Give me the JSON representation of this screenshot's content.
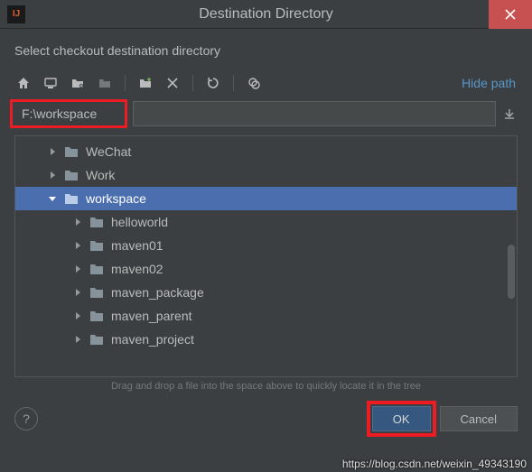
{
  "window": {
    "title": "Destination Directory",
    "app_icon_label": "IJ"
  },
  "prompt": "Select checkout destination directory",
  "toolbar": {
    "hide_path": "Hide path"
  },
  "path_input": {
    "value": "F:\\workspace"
  },
  "tree": {
    "items": [
      {
        "label": "WeChat",
        "depth": 1,
        "expanded": false,
        "selected": false
      },
      {
        "label": "Work",
        "depth": 1,
        "expanded": false,
        "selected": false
      },
      {
        "label": "workspace",
        "depth": 1,
        "expanded": true,
        "selected": true
      },
      {
        "label": "helloworld",
        "depth": 2,
        "expanded": false,
        "selected": false
      },
      {
        "label": "maven01",
        "depth": 2,
        "expanded": false,
        "selected": false
      },
      {
        "label": "maven02",
        "depth": 2,
        "expanded": false,
        "selected": false
      },
      {
        "label": "maven_package",
        "depth": 2,
        "expanded": false,
        "selected": false
      },
      {
        "label": "maven_parent",
        "depth": 2,
        "expanded": false,
        "selected": false
      },
      {
        "label": "maven_project",
        "depth": 2,
        "expanded": false,
        "selected": false
      }
    ]
  },
  "hint": "Drag and drop a file into the space above to quickly locate it in the tree",
  "buttons": {
    "ok": "OK",
    "cancel": "Cancel",
    "help": "?"
  },
  "watermark": "https://blog.csdn.net/weixin_49343190"
}
